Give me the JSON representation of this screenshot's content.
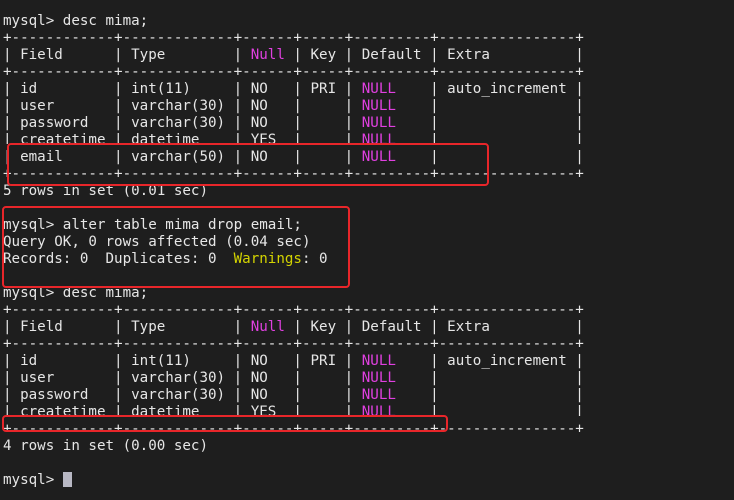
{
  "terminal": {
    "prompt": "mysql> ",
    "commands": {
      "desc1": "desc mima;",
      "alter": "alter table mima drop email;",
      "desc2": "desc mima;"
    },
    "table1": {
      "border": "+------------+-------------+------+-----+---------+----------------+",
      "headers": {
        "field": "| Field      | Type        | ",
        "null": "Null",
        "rest": " | Key | Default | Extra          |"
      },
      "rows": [
        {
          "pre": "| id         | int(11)     | NO   | PRI | ",
          "null": "NULL",
          "post": "    | auto_increment |"
        },
        {
          "pre": "| user       | varchar(30) | NO   |     | ",
          "null": "NULL",
          "post": "    |                |"
        },
        {
          "pre": "| password   | varchar(30) | NO   |     | ",
          "null": "NULL",
          "post": "    |                |"
        },
        {
          "pre": "| createtime | datetime    | YES  |     | ",
          "null": "NULL",
          "post": "    |                |"
        },
        {
          "pre": "| email      | varchar(50) | NO   |     | ",
          "null": "NULL",
          "post": "    |                |"
        }
      ],
      "footer": "5 rows in set (0.01 sec)"
    },
    "alter_result": {
      "query_ok": "Query OK, 0 rows affected (0.04 sec)",
      "records_prefix": "Records: 0  Duplicates: 0  ",
      "warnings_label": "Warnings",
      "warnings_suffix": ": 0"
    },
    "table2": {
      "border": "+------------+-------------+------+-----+---------+----------------+",
      "headers": {
        "field": "| Field      | Type        | ",
        "null": "Null",
        "rest": " | Key | Default | Extra          |"
      },
      "rows": [
        {
          "pre": "| id         | int(11)     | NO   | PRI | ",
          "null": "NULL",
          "post": "    | auto_increment |"
        },
        {
          "pre": "| user       | varchar(30) | NO   |     | ",
          "null": "NULL",
          "post": "    |                |"
        },
        {
          "pre": "| password   | varchar(30) | NO   |     | ",
          "null": "NULL",
          "post": "    |                |"
        },
        {
          "pre": "| createtime | datetime    | YES  |     | ",
          "null": "NULL",
          "post": "    |                |"
        }
      ],
      "footer": "4 rows in set (0.00 sec)"
    },
    "colors": {
      "background": "#1e1e1e",
      "text": "#e6e6e6",
      "null_highlight": "#e040e0",
      "warnings_highlight": "#d4d400",
      "annotation_box": "#e8262a"
    }
  }
}
